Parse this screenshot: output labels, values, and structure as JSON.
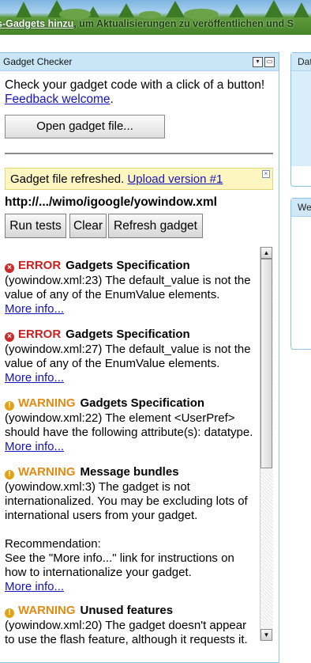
{
  "banner": {
    "link_text": "s-Gadgets hinzu",
    "rest_text": ", um Aktualisierungen zu veröffentlichen und S"
  },
  "side_gadgets": [
    {
      "title": "Dat"
    },
    {
      "title": "We"
    }
  ],
  "checker": {
    "title": "Gadget Checker",
    "intro": "Check your gadget code with a click of a button!",
    "feedback_link": "Feedback welcome",
    "feedback_suffix": ".",
    "open_button": "Open gadget file...",
    "notice_text": "Gadget file refreshed.",
    "notice_link": "Upload version #1",
    "file_path": "http://.../wimo/igoogle/yowindow.xml",
    "buttons": {
      "run": "Run tests",
      "clear": "Clear",
      "refresh": "Refresh gadget"
    }
  },
  "results": [
    {
      "severity": "ERROR",
      "category": "Gadgets Specification",
      "text": "(yowindow.xml:23)  The default_value is not the value of any of the EnumValue elements.",
      "link": "More info..."
    },
    {
      "severity": "ERROR",
      "category": "Gadgets Specification",
      "text": "(yowindow.xml:27)  The default_value is not the value of any of the EnumValue elements.",
      "link": "More info..."
    },
    {
      "severity": "WARNING",
      "category": "Gadgets Specification",
      "text": "(yowindow.xml:22)  The element <UserPref> should have the following attribute(s): datatype.",
      "link": "More info..."
    },
    {
      "severity": "WARNING",
      "category": "Message bundles",
      "text": "(yowindow.xml:3)  The gadget is not internationalized. You may be excluding lots of international users from your gadget.",
      "rec_label": "Recommendation:",
      "rec_text": "See the \"More info...\" link for instructions on how to internationalize your gadget.",
      "link": "More info..."
    },
    {
      "severity": "WARNING",
      "category": "Unused features",
      "text": "(yowindow.xml:20)  The gadget doesn't appear to use the flash feature, although it requests it."
    }
  ],
  "colors": {
    "error": "#cc1f1f",
    "warning": "#e28a12",
    "link": "#1414b8",
    "panel_header": "#c8e6f6"
  },
  "icons": [
    "error-icon",
    "warning-icon",
    "minimize-icon",
    "maximize-icon",
    "close-icon",
    "scroll-up-icon",
    "scroll-down-icon"
  ]
}
